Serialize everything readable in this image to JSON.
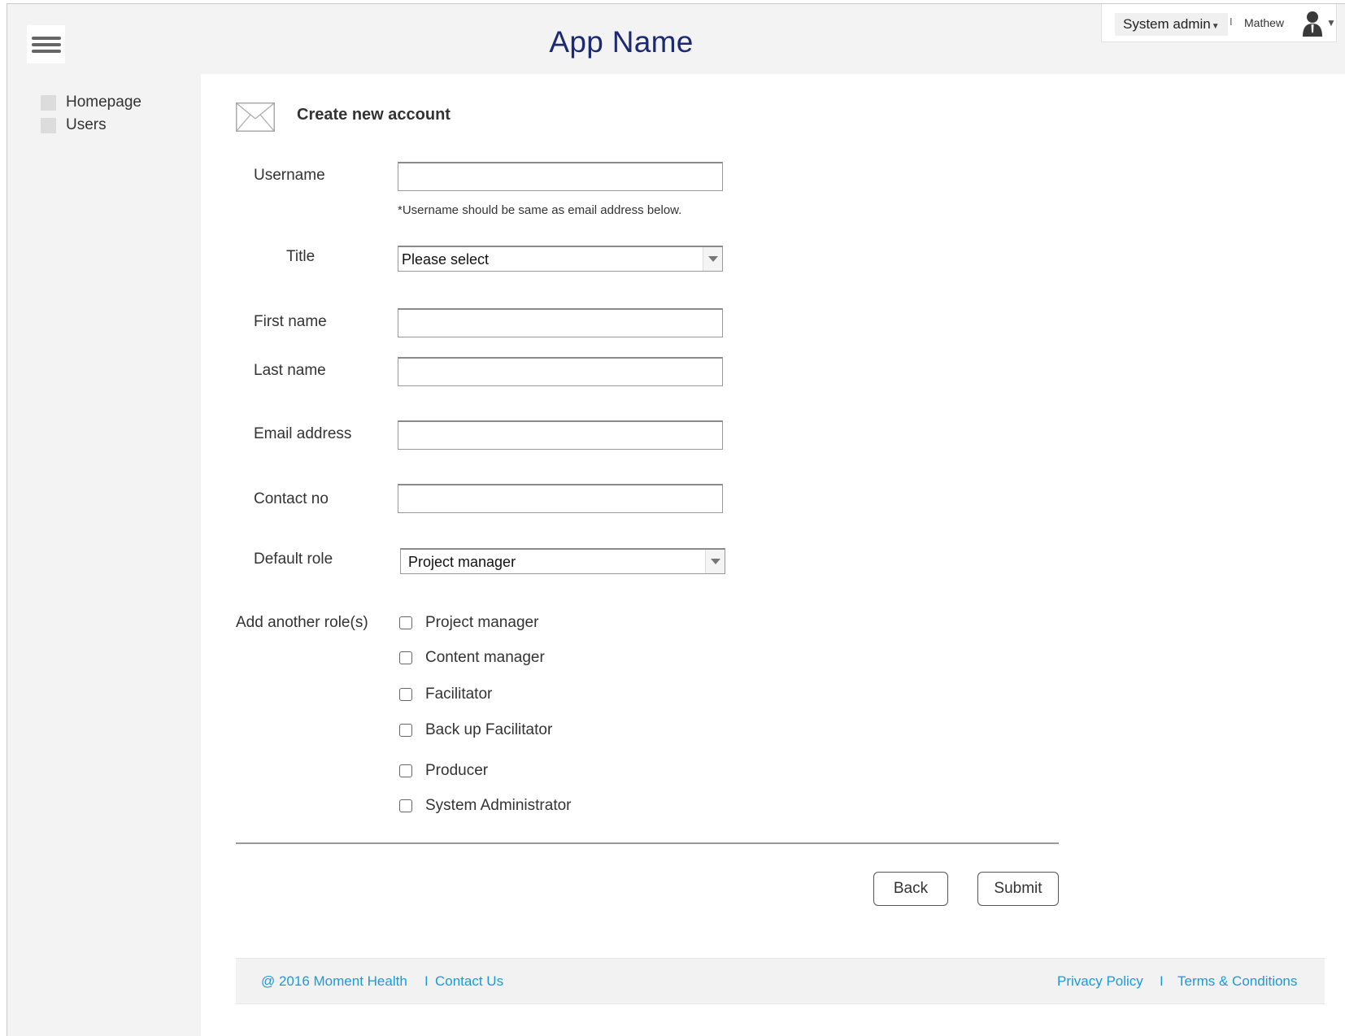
{
  "header": {
    "app_title": "App Name",
    "role_switch": "System admin",
    "user_name": "Mathew",
    "separator": "I",
    "icons": [
      "hamburger-menu-icon",
      "user-avatar-icon",
      "chevron-down-icon"
    ]
  },
  "sidebar": {
    "items": [
      {
        "label": "Homepage"
      },
      {
        "label": "Users"
      }
    ]
  },
  "form": {
    "title": "Create new account",
    "username": {
      "label": "Username",
      "value": "",
      "hint": "*Username should be same as email address below."
    },
    "title_field": {
      "label": "Title",
      "selected": "Please select"
    },
    "first_name": {
      "label": "First name",
      "value": ""
    },
    "last_name": {
      "label": "Last name",
      "value": ""
    },
    "email": {
      "label": "Email address",
      "value": ""
    },
    "contact": {
      "label": "Contact no",
      "value": ""
    },
    "default_role": {
      "label": "Default role",
      "selected": "Project manager"
    },
    "other_roles": {
      "label": "Add another role(s)",
      "options": [
        {
          "label": "Project manager",
          "checked": false
        },
        {
          "label": "Content manager",
          "checked": false
        },
        {
          "label": "Facilitator",
          "checked": false
        },
        {
          "label": "Back up Facilitator",
          "checked": false
        },
        {
          "label": "Producer",
          "checked": false
        },
        {
          "label": "System Administrator",
          "checked": false
        }
      ]
    },
    "back_label": "Back",
    "submit_label": "Submit"
  },
  "footer": {
    "copyright": "@ 2016 Moment Health",
    "sep": "I",
    "contact": "Contact Us",
    "privacy": "Privacy Policy",
    "terms": "Terms & Conditions",
    "link_color": "#1a9ad7"
  },
  "colors": {
    "title_blue": "#1c2a73",
    "panel_gray": "#f3f3f3"
  }
}
